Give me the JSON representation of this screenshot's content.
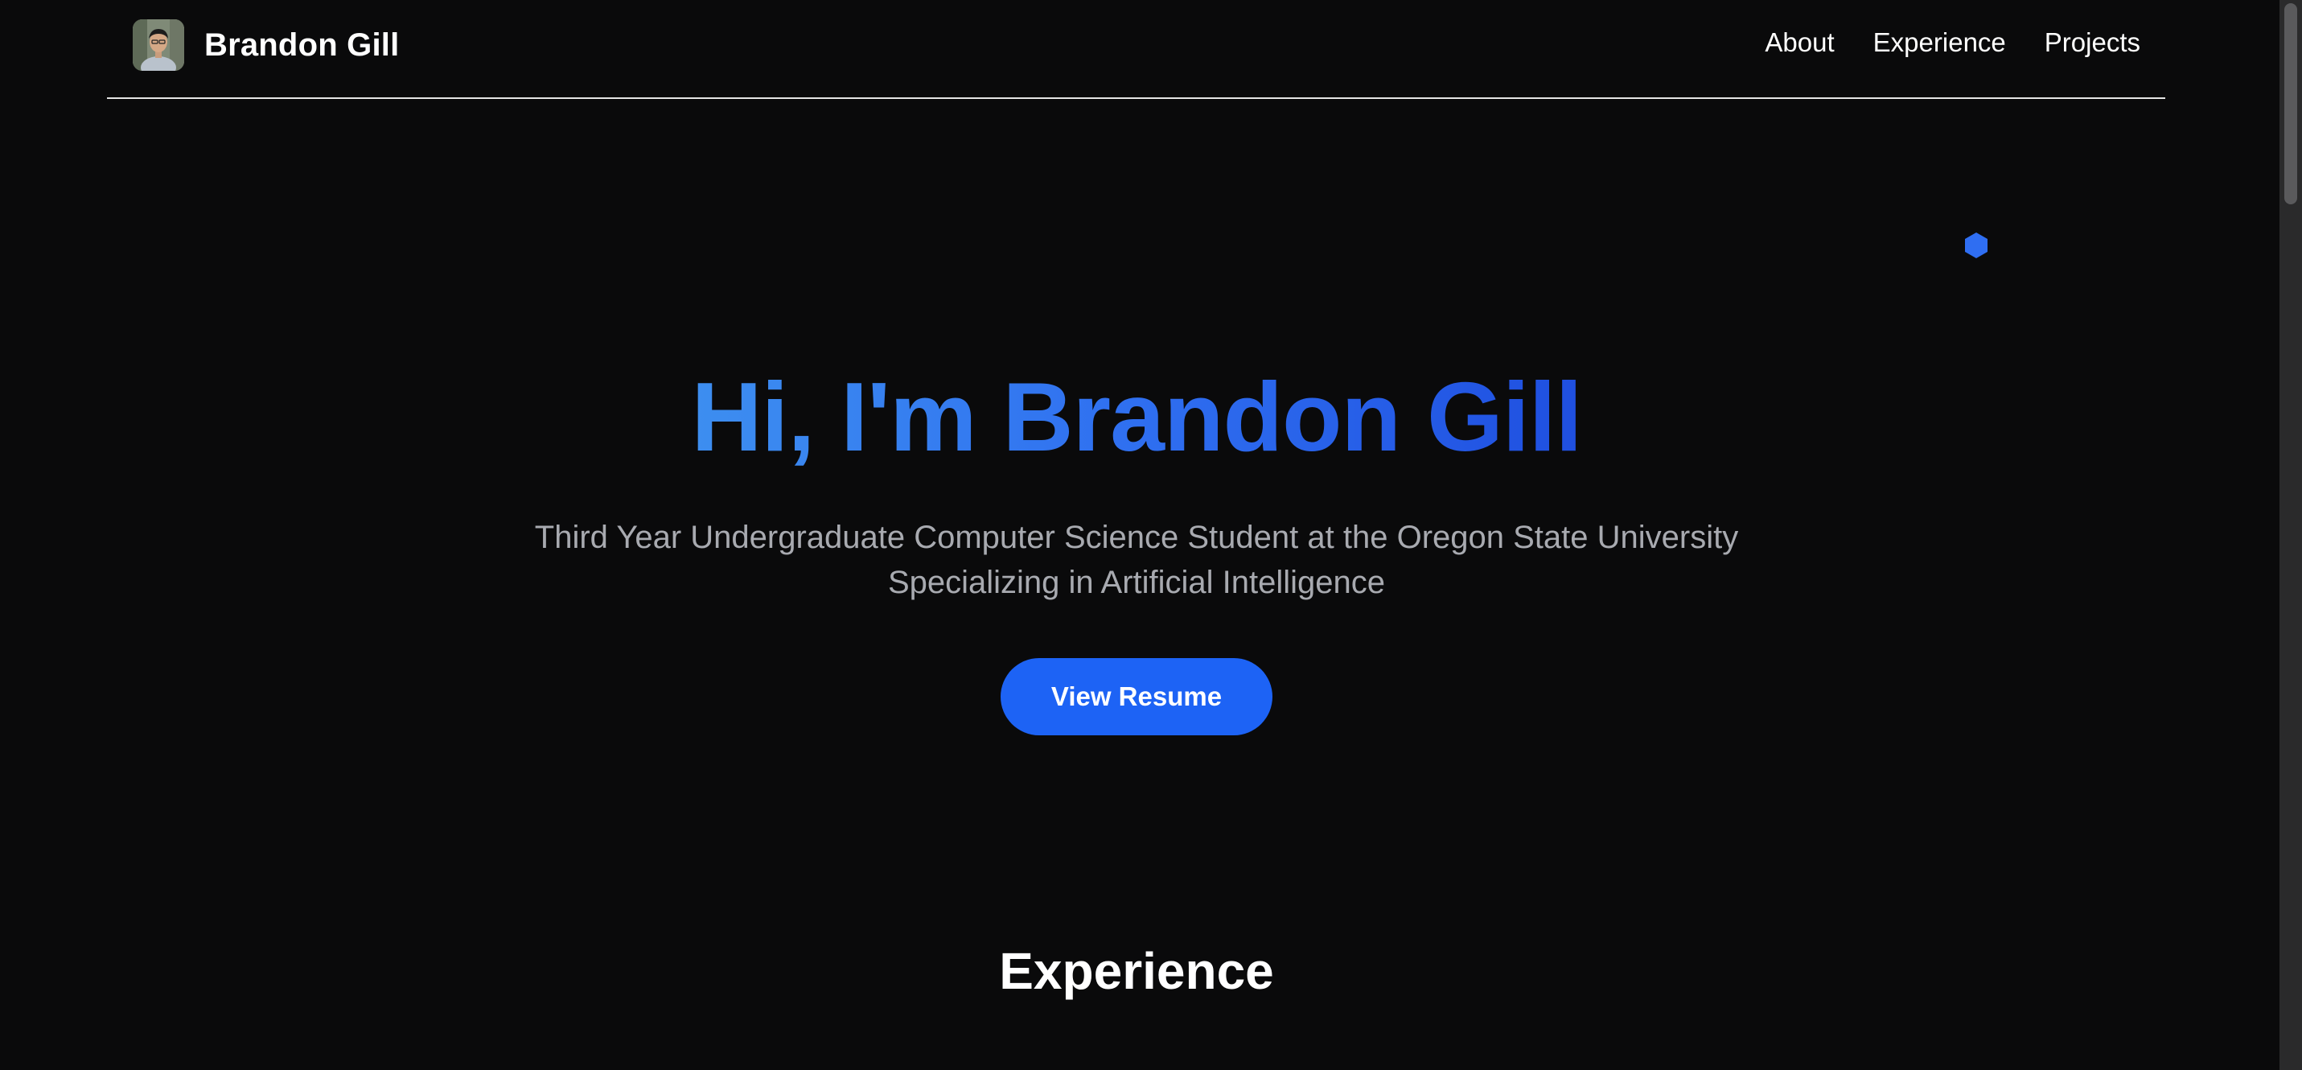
{
  "header": {
    "brand_name": "Brandon Gill",
    "avatar_icon": "profile-photo",
    "nav": [
      {
        "label": "About"
      },
      {
        "label": "Experience"
      },
      {
        "label": "Projects"
      }
    ]
  },
  "hero": {
    "title": "Hi, I'm Brandon Gill",
    "subtitle_line1": "Third Year Undergraduate Computer Science Student at the Oregon State University",
    "subtitle_line2": "Specializing in Artificial Intelligence",
    "button_label": "View Resume",
    "decoration_icon": "hexagon-icon"
  },
  "sections": {
    "experience_title": "Experience"
  },
  "colors": {
    "background": "#0a0a0b",
    "accent": "#1d63f5",
    "title_gradient_start": "#3d8ef0",
    "title_gradient_end": "#1f4fe0",
    "subtitle": "#a8aab0"
  }
}
